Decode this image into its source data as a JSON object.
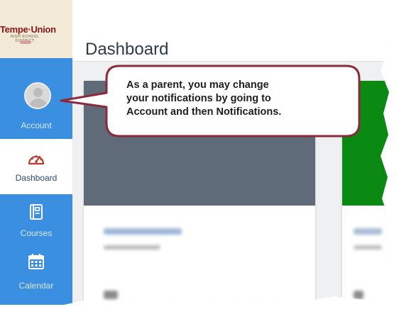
{
  "logo": {
    "title": "Tempe·Union",
    "subtitle": "HIGH SCHOOL DISTRICT"
  },
  "sidebar": {
    "items": [
      {
        "label": "Account",
        "icon": "user-avatar-icon",
        "active": false
      },
      {
        "label": "Dashboard",
        "icon": "speedometer-icon",
        "active": true
      },
      {
        "label": "Courses",
        "icon": "book-icon",
        "active": false
      },
      {
        "label": "Calendar",
        "icon": "calendar-icon",
        "active": false
      }
    ]
  },
  "header": {
    "title": "Dashboard"
  },
  "cards": [
    {
      "color": "#5f6b78"
    },
    {
      "color": "#0a8a12"
    }
  ],
  "callout": {
    "lines": [
      "As a parent, you may change",
      "your notifications by going to",
      "Account  and then  Notifications."
    ]
  },
  "colors": {
    "sidebar": "#3a8fe0",
    "active_item_bg": "#ffffff",
    "callout_border": "#8b2a3a",
    "page_bg": "#eef0f2"
  }
}
